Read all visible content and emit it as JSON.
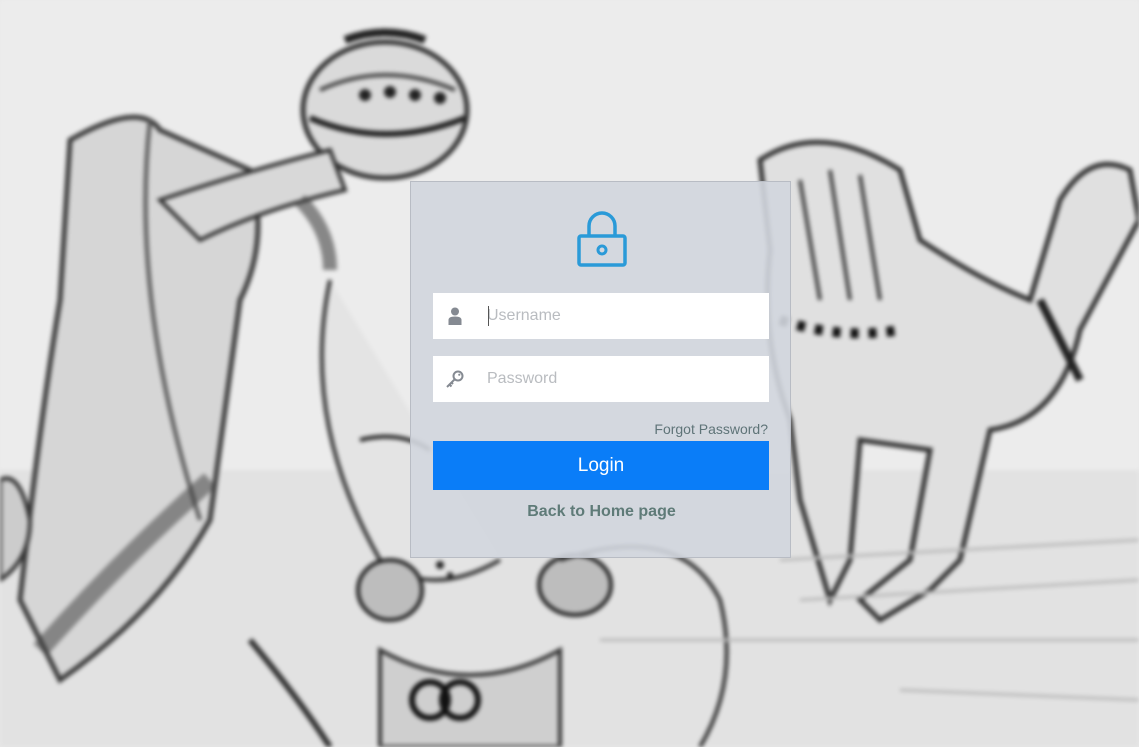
{
  "login_form": {
    "username_placeholder": "Username",
    "password_placeholder": "Password",
    "forgot_password": "Forgot Password?",
    "login_button": "Login",
    "back_to_home": "Back to Home page"
  },
  "icons": {
    "header": "lock-icon",
    "username": "user-icon",
    "password": "key-icon"
  },
  "colors": {
    "accent": "#0a7df8",
    "lock_icon": "#2a9ad8",
    "link": "#5f7b78",
    "card_background": "#d2d6de"
  }
}
